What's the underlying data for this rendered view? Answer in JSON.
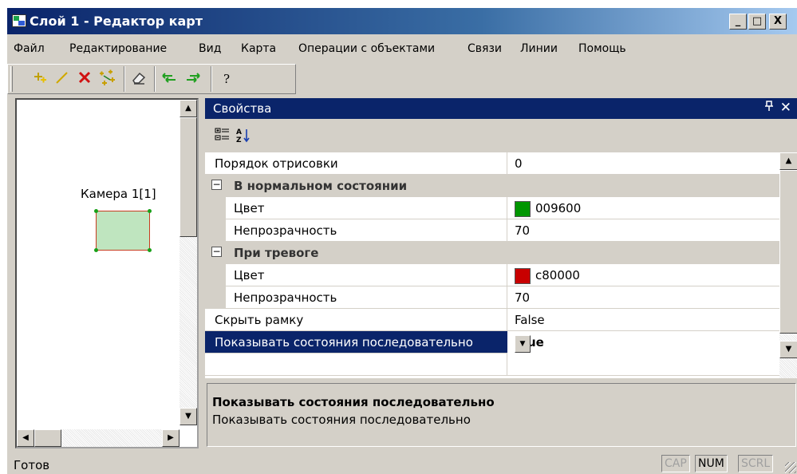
{
  "window": {
    "title": "Слой 1 - Редактор карт",
    "minimize": "_",
    "maximize": "□",
    "close": "X"
  },
  "menu": [
    {
      "label": "Файл"
    },
    {
      "label": "Редактирование"
    },
    {
      "label": "Вид"
    },
    {
      "label": "Карта"
    },
    {
      "label": "Операции с объектами"
    },
    {
      "label": "Связи"
    },
    {
      "label": "Линии"
    },
    {
      "label": "Помощь"
    }
  ],
  "toolbar": {
    "icons": [
      "add-point-icon",
      "draw-line-icon",
      "delete-icon",
      "edit-points-icon",
      "eraser-icon",
      "undo-icon",
      "redo-icon",
      "help-icon"
    ],
    "help_label": "?"
  },
  "map": {
    "camera_label": "Камера 1[1]",
    "camera_fill": "#bfe5bf",
    "camera_border": "#c83c20"
  },
  "properties": {
    "title": "Свойства",
    "pin": "ᵖ",
    "close": "✕",
    "rows": [
      {
        "name": "Порядок отрисовки",
        "value": "0"
      },
      {
        "name": "В нормальном состоянии",
        "category": true,
        "expanded": true
      },
      {
        "name": "Цвет",
        "value": "009600",
        "color": "#009600"
      },
      {
        "name": "Непрозрачность",
        "value": "70"
      },
      {
        "name": "При тревоге",
        "category": true,
        "expanded": true
      },
      {
        "name": "Цвет",
        "value": "c80000",
        "color": "#c80000"
      },
      {
        "name": "Непрозрачность",
        "value": "70"
      },
      {
        "name": "Скрыть рамку",
        "value": "False"
      },
      {
        "name": "Показывать состояния последовательно",
        "value": "True",
        "selected": true
      }
    ],
    "description": {
      "title": "Показывать состояния последовательно",
      "text": "Показывать состояния последовательно"
    }
  },
  "status": {
    "text": "Готов",
    "cap": "CAP",
    "num": "NUM",
    "scrl": "SCRL"
  },
  "colors": {
    "titlebar": "#0a246a",
    "selection": "#0a246a",
    "chrome": "#d4d0c8"
  }
}
